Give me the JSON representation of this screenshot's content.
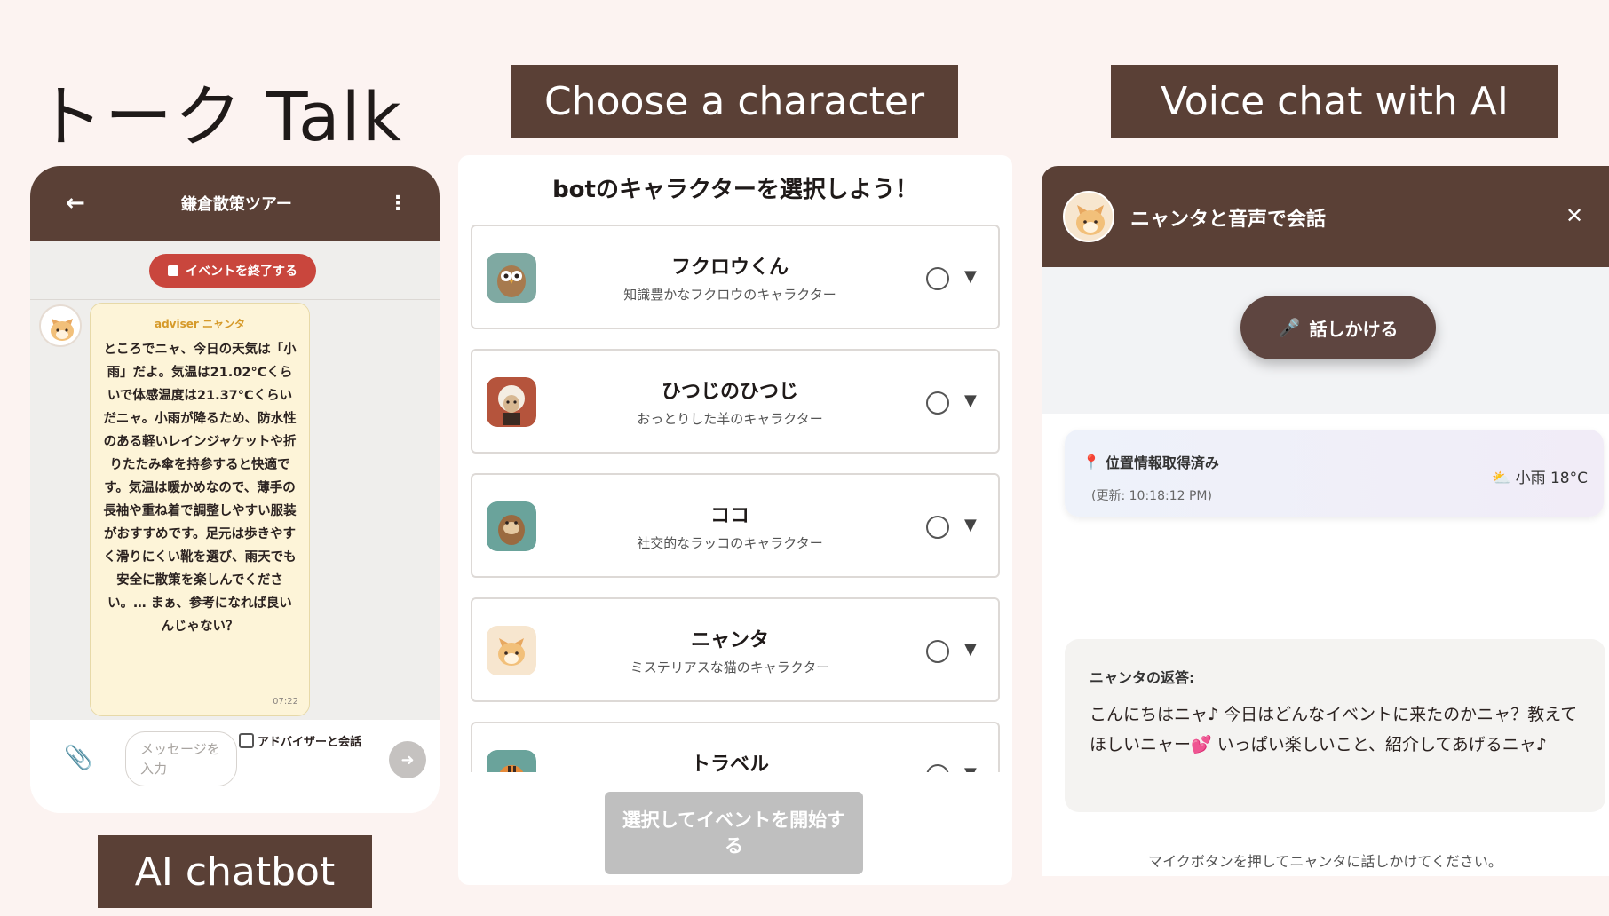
{
  "page": {
    "title": "トーク  Talk"
  },
  "labels": {
    "choose": "Choose a character",
    "voice": "Voice chat with AI",
    "chatbot": "AI chatbot"
  },
  "chat": {
    "header_title": "鎌倉散策ツアー",
    "back_icon": "←",
    "more_icon": "⋮",
    "end_event": "イベントを終了する",
    "sender": "adviser ニャンタ",
    "message": "ところでニャ、今日の天気は「小雨」だよ。気温は21.02°Cくらいで体感温度は21.37°Cくらいだニャ。小雨が降るため、防水性のある軽いレインジャケットや折りたたみ傘を持参すると快適です。気温は暖かめなので、薄手の長袖や重ね着で調整しやすい服装がおすすめです。足元は歩きやすく滑りにくい靴を選び、雨天でも安全に散策を楽しんでください。… まぁ、参考になれば良いんじゃない？",
    "time": "07:22",
    "input_placeholder": "メッセージを入力",
    "advisor_toggle": "アドバイザーと会話",
    "send_icon": "➜",
    "clip_icon": "📎"
  },
  "select": {
    "title": "botのキャラクターを選択しよう！",
    "characters": [
      {
        "name": "フクロウくん",
        "desc": "知識豊かなフクロウのキャラクター"
      },
      {
        "name": "ひつじのひつじ",
        "desc": "おっとりした羊のキャラクター"
      },
      {
        "name": "ココ",
        "desc": "社交的なラッコのキャラクター"
      },
      {
        "name": "ニャンタ",
        "desc": "ミステリアスな猫のキャラクター"
      },
      {
        "name": "トラベル",
        "desc": ""
      }
    ],
    "start_button": "選択してイベントを開始する",
    "caret_icon": "▼"
  },
  "voice": {
    "header_title": "ニャンタと音声で会話",
    "close_icon": "✕",
    "talk_button": "話しかける",
    "mic_icon": "🎤",
    "location_status": "位置情報取得済み",
    "location_icon": "📍",
    "updated": "(更新: 10:18:12 PM)",
    "weather": "⛅ 小雨 18°C",
    "reply_label": "ニャンタの返答:",
    "reply_text": "こんにちはニャ♪ 今日はどんなイベントに来たのかニャ？教えてほしいニャー💕 いっぱい楽しいこと、紹介してあげるニャ♪",
    "hint": "マイクボタンを押してニャンタに話しかけてください。"
  },
  "colors": {
    "brown": "#5a4036",
    "end_red": "#c9463d",
    "bubble": "#fdf4d8",
    "disabled": "#bfbfbf"
  }
}
